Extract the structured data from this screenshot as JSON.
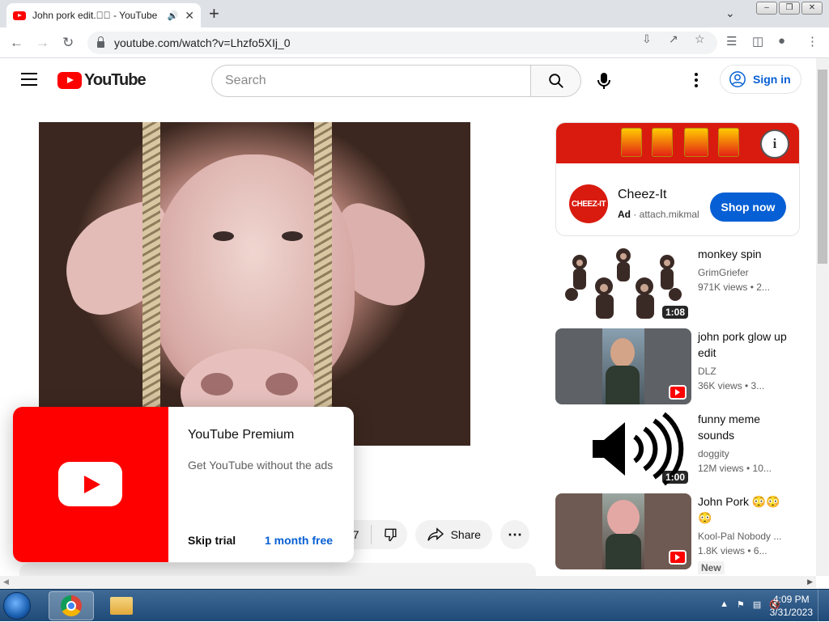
{
  "browser": {
    "tab_title": "John pork edit.\u0000\u0000 - YouTube",
    "url": "youtube.com/watch?v=Lhzfo5XIj_0",
    "new_tab_label": "+"
  },
  "youtube": {
    "logo_text": "YouTube",
    "search_placeholder": "Search",
    "signin_label": "Sign in"
  },
  "video_actions": {
    "like_count": "77",
    "share_label": "Share"
  },
  "premium_popup": {
    "title": "YouTube Premium",
    "subtitle": "Get YouTube without the ads",
    "skip_label": "Skip trial",
    "trial_label": "1 month free"
  },
  "ad": {
    "advertiser": "Cheez-It",
    "logo_text": "CHEEZ-IT",
    "ad_label": "Ad",
    "domain": "attach.mikmal",
    "cta": "Shop now"
  },
  "recommendations": [
    {
      "title": "monkey spin",
      "channel": "GrimGriefer",
      "stats": "971K views • 2...",
      "duration": "1:08",
      "type": "video"
    },
    {
      "title": "john pork glow up edit",
      "channel": "DLZ",
      "stats": "36K views • 3...",
      "duration": "",
      "type": "short"
    },
    {
      "title": "funny meme sounds",
      "channel": "doggity",
      "stats": "12M views • 10...",
      "duration": "1:00",
      "type": "video"
    },
    {
      "title": "John Pork 😳😳😳",
      "channel": "Kool-Pal Nobody ...",
      "stats": "1.8K views • 6...",
      "duration": "",
      "type": "short",
      "badge": "New"
    }
  ],
  "taskbar": {
    "time": "4:09 PM",
    "date": "3/31/2023"
  },
  "colors": {
    "youtube_red": "#ff0000",
    "link_blue": "#065fd4",
    "ad_red": "#d91b0f"
  }
}
